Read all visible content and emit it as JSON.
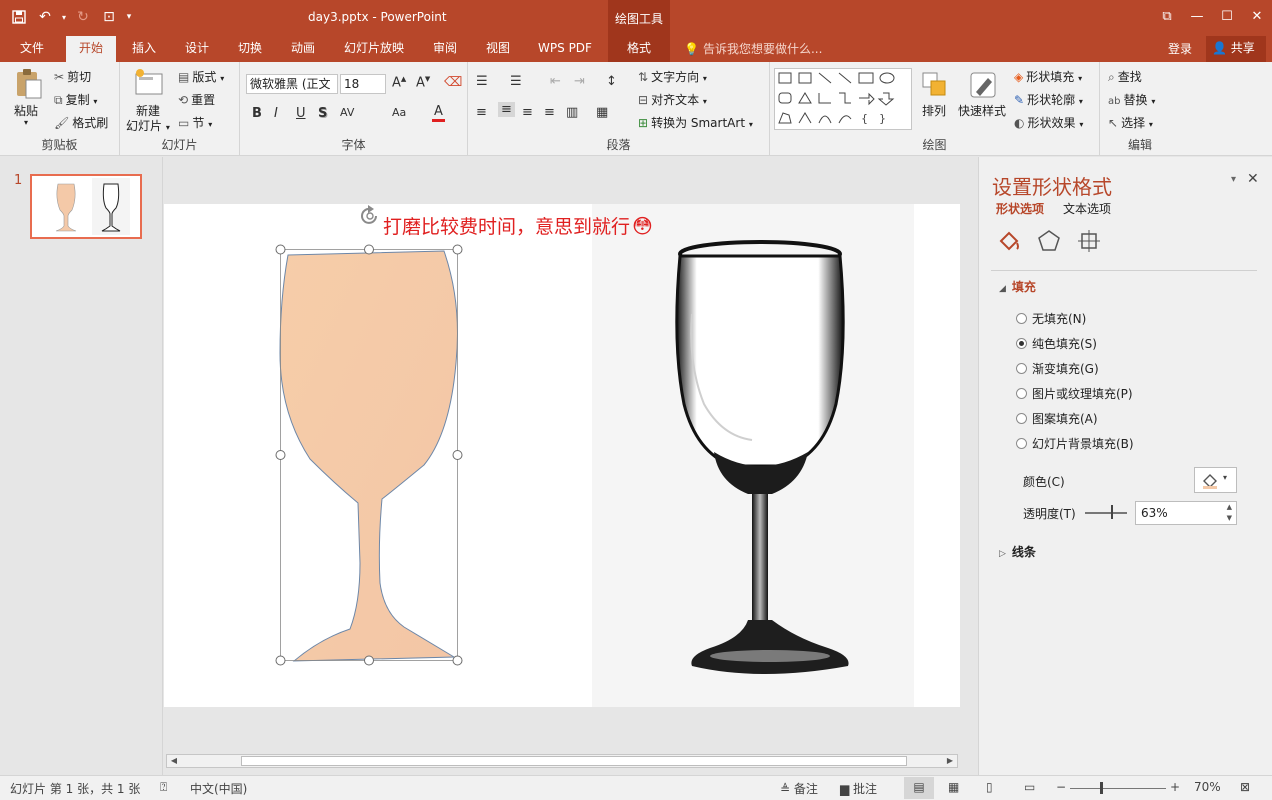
{
  "window": {
    "doc_title": "day3.pptx - PowerPoint",
    "context_header": "绘图工具",
    "controls": [
      "⧉",
      "—",
      "☐",
      "✕"
    ]
  },
  "tabs": {
    "file": "文件",
    "home": "开始",
    "insert": "插入",
    "design": "设计",
    "transitions": "切换",
    "animations": "动画",
    "slideshow": "幻灯片放映",
    "review": "审阅",
    "view": "视图",
    "wps_pdf": "WPS PDF",
    "format": "格式",
    "tell_me": "告诉我您想要做什么...",
    "login": "登录",
    "share": "共享"
  },
  "ribbon": {
    "clipboard": {
      "label": "剪贴板",
      "paste": "粘贴",
      "cut": "剪切",
      "copy": "复制",
      "format_painter": "格式刷"
    },
    "slides": {
      "label": "幻灯片",
      "new_slide_1": "新建",
      "new_slide_2": "幻灯片",
      "layout": "版式",
      "reset": "重置",
      "section": "节"
    },
    "font": {
      "label": "字体",
      "font_name": "微软雅黑 (正文",
      "font_size": "18",
      "buttons": [
        "B",
        "I",
        "U",
        "S",
        "AV",
        "Aa",
        "A"
      ]
    },
    "paragraph": {
      "label": "段落",
      "text_direction": "文字方向",
      "align_text": "对齐文本",
      "smartart": "转换为 SmartArt"
    },
    "drawing": {
      "label": "绘图",
      "arrange": "排列",
      "quick_styles": "快速样式",
      "shape_fill": "形状填充",
      "shape_outline": "形状轮廓",
      "shape_effects": "形状效果"
    },
    "editing": {
      "label": "编辑",
      "find": "查找",
      "replace": "替换",
      "select": "选择"
    }
  },
  "thumbnails": {
    "slide_number": "1"
  },
  "slide": {
    "caption": "打磨比较费时间，意思到就行",
    "emoji": "😳"
  },
  "format_pane": {
    "title": "设置形状格式",
    "tab_shape": "形状选项",
    "tab_text": "文本选项",
    "fill_section": "填充",
    "options": [
      {
        "label": "无填充(N)",
        "selected": false
      },
      {
        "label": "纯色填充(S)",
        "selected": true
      },
      {
        "label": "渐变填充(G)",
        "selected": false
      },
      {
        "label": "图片或纹理填充(P)",
        "selected": false
      },
      {
        "label": "图案填充(A)",
        "selected": false
      },
      {
        "label": "幻灯片背景填充(B)",
        "selected": false
      }
    ],
    "color_label": "颜色(C)",
    "transparency_label": "透明度(T)",
    "transparency_value": "63%",
    "line_section": "线条",
    "fill_color": "#f4c9a8"
  },
  "statusbar": {
    "slide_info": "幻灯片 第 1 张，共 1 张",
    "language": "中文(中国)",
    "notes": "备注",
    "comments": "批注",
    "zoom": "70%"
  },
  "colors": {
    "accent": "#b7472a",
    "accent_dark": "#a0361c"
  }
}
